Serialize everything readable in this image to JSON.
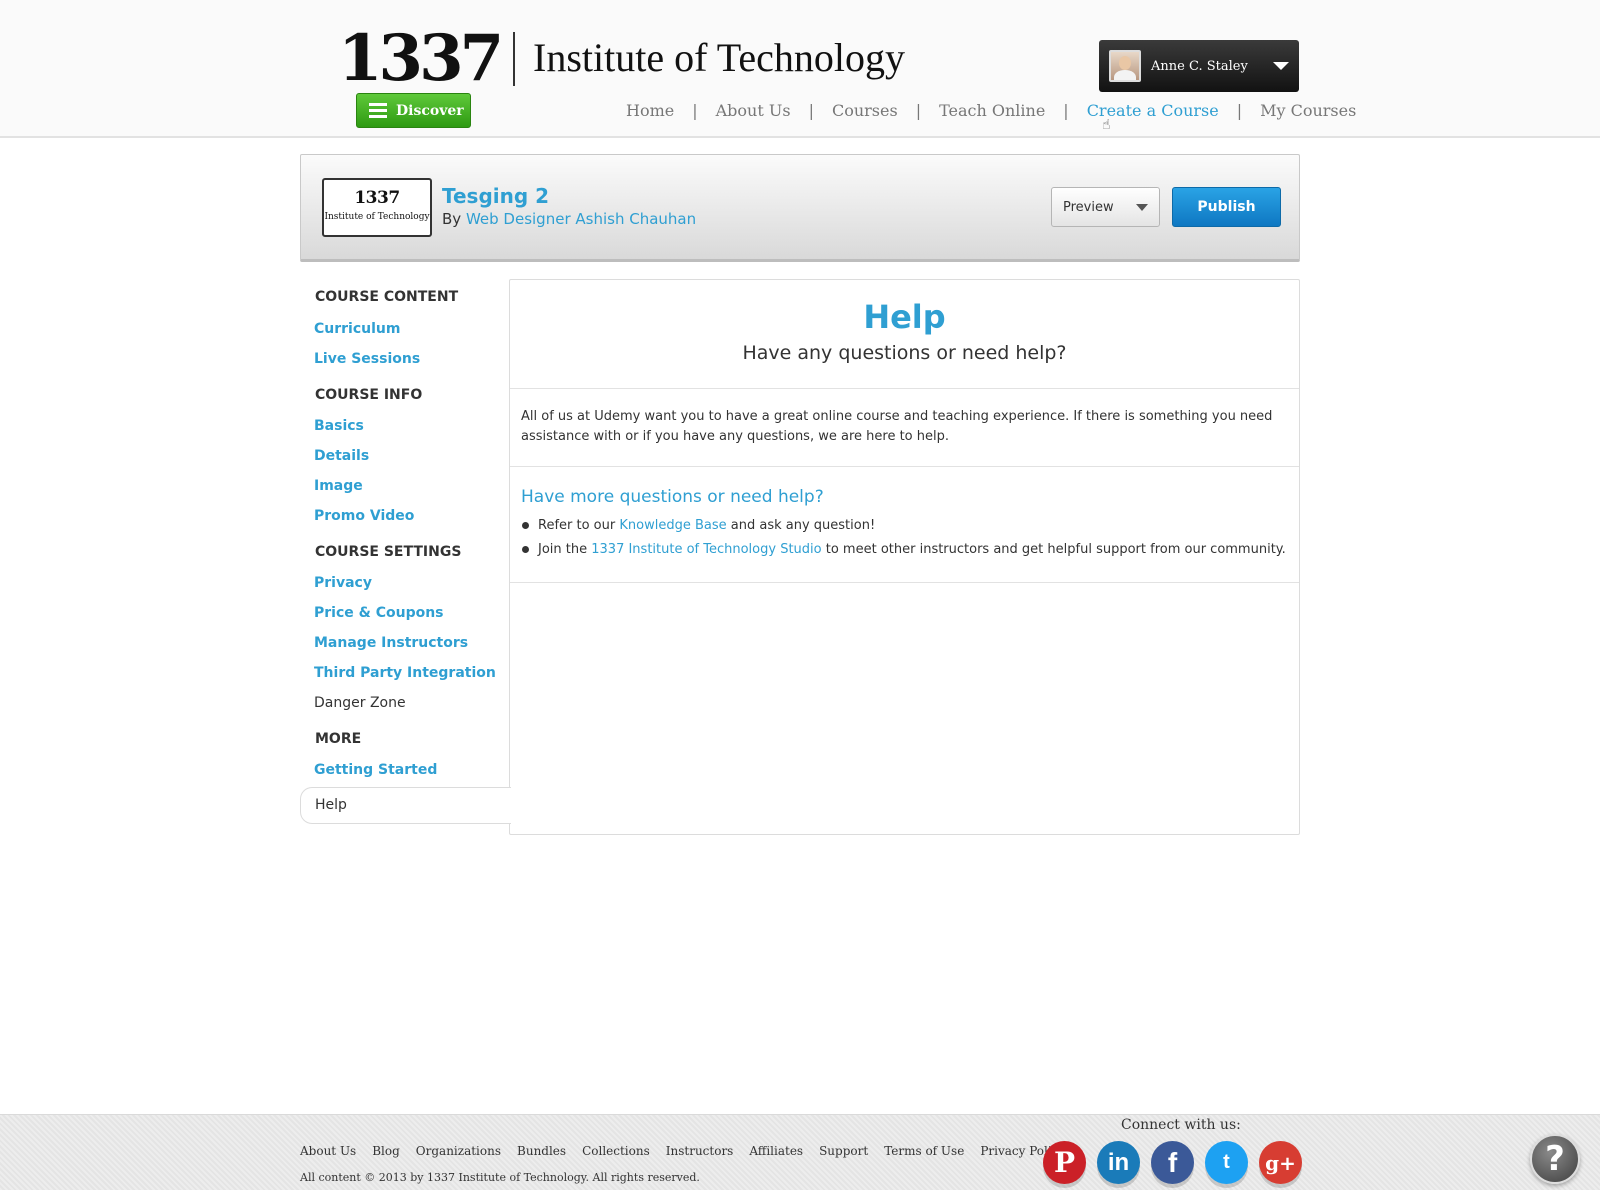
{
  "header": {
    "logo_number": "1337",
    "logo_text": "Institute of Technology",
    "discover_label": "Discover",
    "user_name": "Anne C. Staley",
    "nav": [
      "Home",
      "About Us",
      "Courses",
      "Teach Online",
      "Create a Course",
      "My Courses"
    ],
    "nav_separator": "|"
  },
  "course": {
    "thumb_number": "1337",
    "thumb_text": "Institute of Technology",
    "title": "Tesging 2",
    "by_label": "By",
    "author": "Web Designer Ashish Chauhan",
    "preview_label": "Preview",
    "publish_label": "Publish"
  },
  "sidebar": {
    "course_content": "COURSE CONTENT",
    "curriculum": "Curriculum",
    "live_sessions": "Live Sessions",
    "course_info": "COURSE INFO",
    "basics": "Basics",
    "details": "Details",
    "image": "Image",
    "promo_video": "Promo Video",
    "course_settings": "COURSE SETTINGS",
    "privacy": "Privacy",
    "price_coupons": "Price & Coupons",
    "manage_instructors": "Manage Instructors",
    "third_party": "Third Party Integration",
    "danger_zone": "Danger Zone",
    "more": "MORE",
    "getting_started": "Getting Started",
    "help": "Help"
  },
  "main": {
    "title": "Help",
    "subtitle": "Have any questions or need help?",
    "intro": "All of us at Udemy want you to have a great online course and teaching experience. If there is something you need assistance with or if you have any questions, we are here to help.",
    "more_title": "Have more questions or need help?",
    "item1_pre": "Refer to our",
    "item1_link": "Knowledge Base",
    "item1_post": "and ask any question!",
    "item2_pre": "Join the",
    "item2_link": "1337 Institute of Technology Studio",
    "item2_post": "to meet other instructors and get helpful support from our community."
  },
  "footer": {
    "links": [
      "About Us",
      "Blog",
      "Organizations",
      "Bundles",
      "Collections",
      "Instructors",
      "Affiliates",
      "Support",
      "Terms of Use",
      "Privacy Policy"
    ],
    "copyright": "All content © 2013 by 1337 Institute of Technology. All rights reserved.",
    "connect": "Connect with us:",
    "socials": {
      "pinterest": "P",
      "linkedin": "in",
      "facebook": "f",
      "twitter": "t",
      "gplus": "g+"
    },
    "help_fab": "?"
  },
  "colors": {
    "link_blue": "#2f9fd2",
    "discover_green": "#3aa81a",
    "publish_blue": "#1a8ad4"
  }
}
